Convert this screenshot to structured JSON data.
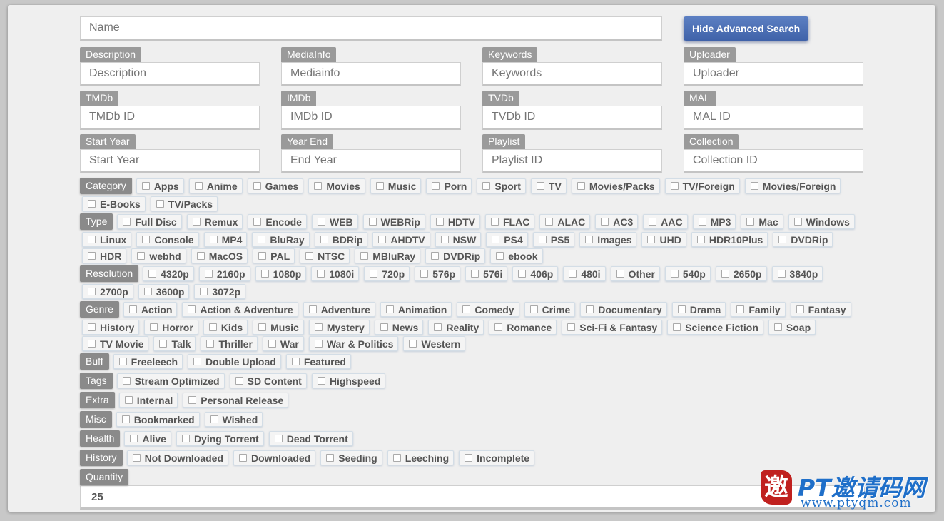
{
  "search": {
    "name_placeholder": "Name",
    "advanced_button": "Hide Advanced Search"
  },
  "fields": [
    [
      {
        "label": "Description",
        "placeholder": "Description"
      },
      {
        "label": "MediaInfo",
        "placeholder": "Mediainfo"
      },
      {
        "label": "Keywords",
        "placeholder": "Keywords"
      },
      {
        "label": "Uploader",
        "placeholder": "Uploader"
      }
    ],
    [
      {
        "label": "TMDb",
        "placeholder": "TMDb ID"
      },
      {
        "label": "IMDb",
        "placeholder": "IMDb ID"
      },
      {
        "label": "TVDb",
        "placeholder": "TVDb ID"
      },
      {
        "label": "MAL",
        "placeholder": "MAL ID"
      }
    ],
    [
      {
        "label": "Start Year",
        "placeholder": "Start Year"
      },
      {
        "label": "Year End",
        "placeholder": "End Year"
      },
      {
        "label": "Playlist",
        "placeholder": "Playlist ID"
      },
      {
        "label": "Collection",
        "placeholder": "Collection ID"
      }
    ]
  ],
  "groups": [
    {
      "label": "Category",
      "options": [
        "Apps",
        "Anime",
        "Games",
        "Movies",
        "Music",
        "Porn",
        "Sport",
        "TV",
        "Movies/Packs",
        "TV/Foreign",
        "Movies/Foreign",
        "E-Books",
        "TV/Packs"
      ]
    },
    {
      "label": "Type",
      "options": [
        "Full Disc",
        "Remux",
        "Encode",
        "WEB",
        "WEBRip",
        "HDTV",
        "FLAC",
        "ALAC",
        "AC3",
        "AAC",
        "MP3",
        "Mac",
        "Windows",
        "Linux",
        "Console",
        "MP4",
        "BluRay",
        "BDRip",
        "AHDTV",
        "NSW",
        "PS4",
        "PS5",
        "Images",
        "UHD",
        "HDR10Plus",
        "DVDRip",
        "HDR",
        "webhd",
        "MacOS",
        "PAL",
        "NTSC",
        "MBluRay",
        "DVDRip",
        "ebook"
      ]
    },
    {
      "label": "Resolution",
      "options": [
        "4320p",
        "2160p",
        "1080p",
        "1080i",
        "720p",
        "576p",
        "576i",
        "406p",
        "480i",
        "Other",
        "540p",
        "2650p",
        "3840p",
        "2700p",
        "3600p",
        "3072p"
      ]
    },
    {
      "label": "Genre",
      "options": [
        "Action",
        "Action & Adventure",
        "Adventure",
        "Animation",
        "Comedy",
        "Crime",
        "Documentary",
        "Drama",
        "Family",
        "Fantasy",
        "History",
        "Horror",
        "Kids",
        "Music",
        "Mystery",
        "News",
        "Reality",
        "Romance",
        "Sci-Fi & Fantasy",
        "Science Fiction",
        "Soap",
        "TV Movie",
        "Talk",
        "Thriller",
        "War",
        "War & Politics",
        "Western"
      ]
    },
    {
      "label": "Buff",
      "options": [
        "Freeleech",
        "Double Upload",
        "Featured"
      ]
    },
    {
      "label": "Tags",
      "options": [
        "Stream Optimized",
        "SD Content",
        "Highspeed"
      ]
    },
    {
      "label": "Extra",
      "options": [
        "Internal",
        "Personal Release"
      ]
    },
    {
      "label": "Misc",
      "options": [
        "Bookmarked",
        "Wished"
      ]
    },
    {
      "label": "Health",
      "options": [
        "Alive",
        "Dying Torrent",
        "Dead Torrent"
      ]
    },
    {
      "label": "History",
      "options": [
        "Not Downloaded",
        "Downloaded",
        "Seeding",
        "Leeching",
        "Incomplete"
      ]
    }
  ],
  "quantity": {
    "label": "Quantity",
    "value": "25"
  },
  "watermark": {
    "glyph": "邀",
    "title": "PT邀请码网",
    "url": "www.ptyqm.com"
  }
}
